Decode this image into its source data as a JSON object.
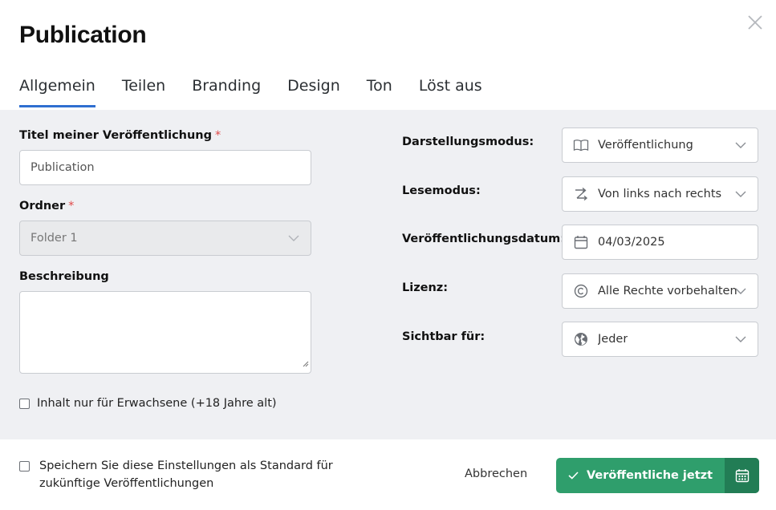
{
  "dialog": {
    "title": "Publication",
    "close_icon": "close-icon"
  },
  "tabs": [
    {
      "label": "Allgemein",
      "active": true
    },
    {
      "label": "Teilen",
      "active": false
    },
    {
      "label": "Branding",
      "active": false
    },
    {
      "label": "Design",
      "active": false
    },
    {
      "label": "Ton",
      "active": false
    },
    {
      "label": "Löst aus",
      "active": false
    }
  ],
  "left": {
    "title_label": "Titel meiner Veröffentlichung",
    "required_mark": "*",
    "title_value": "Publication",
    "folder_label": "Ordner",
    "folder_value": "Folder 1",
    "description_label": "Beschreibung",
    "description_value": "",
    "adult_label": "Inhalt nur für Erwachsene (+18 Jahre alt)",
    "adult_checked": false
  },
  "right": {
    "display_mode_label": "Darstellungsmodus:",
    "display_mode_value": "Veröffentlichung",
    "display_mode_icon": "book-icon",
    "reading_mode_label": "Lesemodus:",
    "reading_mode_value": "Von links nach rechts",
    "reading_mode_icon": "direction-icon",
    "date_label": "Veröffentlichungsdatum:",
    "date_value": "04/03/2025",
    "date_icon": "calendar-icon",
    "license_label": "Lizenz:",
    "license_value": "Alle Rechte vorbehalten",
    "license_icon": "copyright-icon",
    "visible_label": "Sichtbar für:",
    "visible_value": "Jeder",
    "visible_icon": "globe-icon"
  },
  "footer": {
    "save_default_label": "Speichern Sie diese Einstellungen als Standard für zukünftige Veröffentlichungen",
    "save_default_checked": false,
    "cancel_label": "Abbrechen",
    "publish_label": "Veröffentliche jetzt",
    "publish_icon": "check-icon",
    "schedule_icon": "calendar-icon"
  },
  "colors": {
    "accent_tab": "#2f6fd0",
    "publish_green": "#2f9e6c",
    "publish_green_dark": "#227d55",
    "required_red": "#e04848",
    "panel_bg": "#eff0f3"
  }
}
